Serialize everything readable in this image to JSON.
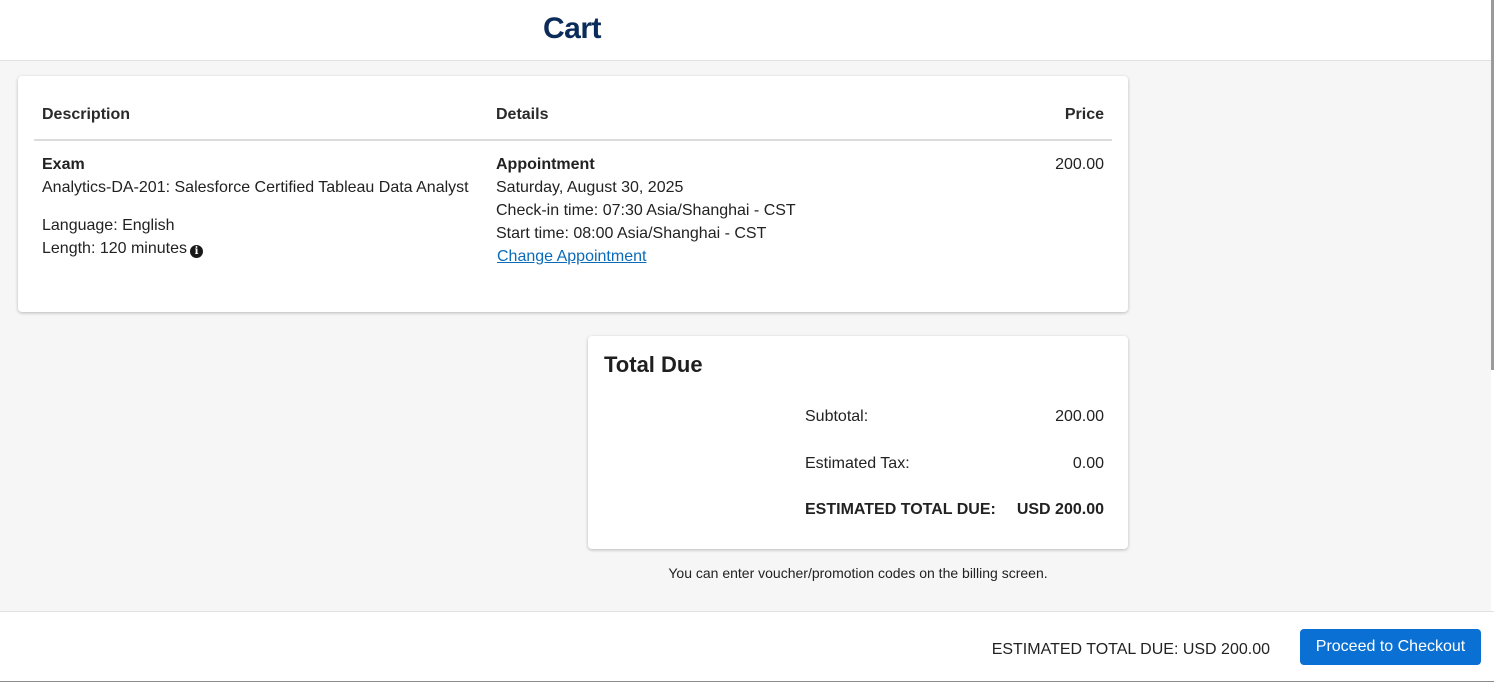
{
  "header": {
    "title": "Cart"
  },
  "cart": {
    "columns": {
      "description": "Description",
      "details": "Details",
      "price": "Price"
    },
    "item": {
      "type": "Exam",
      "name": "Analytics-DA-201: Salesforce Certified Tableau Data Analyst",
      "language": "Language: English",
      "length": "Length: 120 minutes",
      "details_title": "Appointment",
      "date": "Saturday, August 30, 2025",
      "checkin": "Check-in time: 07:30 Asia/Shanghai - CST",
      "start": "Start time: 08:00 Asia/Shanghai - CST",
      "change_link": "Change Appointment",
      "price": "200.00"
    }
  },
  "total": {
    "title": "Total Due",
    "subtotal_label": "Subtotal:",
    "subtotal_value": "200.00",
    "tax_label": "Estimated Tax:",
    "tax_value": "0.00",
    "total_label": "ESTIMATED TOTAL DUE:",
    "total_value": "USD 200.00"
  },
  "voucher_note": "You can enter voucher/promotion codes on the billing screen.",
  "footer": {
    "total_text": "ESTIMATED TOTAL DUE: USD 200.00",
    "checkout_label": "Proceed to Checkout"
  },
  "colors": {
    "title": "#0b2c5a",
    "link": "#0b6bb8",
    "button": "#0a70d4"
  },
  "icons": {
    "info": "info-icon"
  }
}
